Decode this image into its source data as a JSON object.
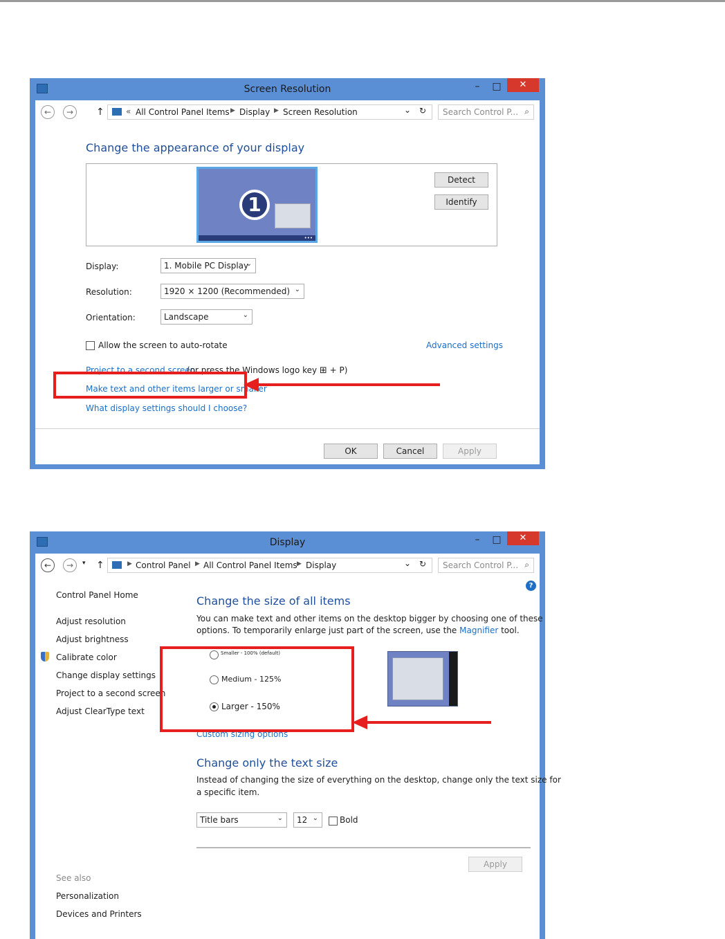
{
  "window1": {
    "title": "Screen Resolution",
    "minimize": "–",
    "maximize": "□",
    "close": "✕",
    "address": {
      "back": "←",
      "forward": "→",
      "up": "↑",
      "overflow": "«",
      "crumbs": [
        "All Control Panel Items",
        "Display",
        "Screen Resolution"
      ],
      "dropdown": "⌄",
      "refresh": "↻",
      "search_placeholder": "Search Control P...",
      "search_icon": "magnifier-icon"
    },
    "heading": "Change the appearance of your display",
    "monitor_number": "1",
    "monitor_dots": "•••",
    "detect": "Detect",
    "identify": "Identify",
    "display_label": "Display:",
    "display_value": "1. Mobile PC Display",
    "resolution_label": "Resolution:",
    "resolution_value": "1920 × 1200 (Recommended)",
    "orientation_label": "Orientation:",
    "orientation_value": "Landscape",
    "autorotate_label": "Allow the screen to auto-rotate",
    "advanced_link": "Advanced settings",
    "project_link": "Project to a second screen",
    "project_suffix_a": " (or press the Windows logo key ",
    "project_suffix_b": " + P)",
    "larger_link": "Make text and other items larger or smaller",
    "which_link": "What display settings should I choose?",
    "ok": "OK",
    "cancel": "Cancel",
    "apply": "Apply"
  },
  "window2": {
    "title": "Display",
    "minimize": "–",
    "maximize": "□",
    "close": "✕",
    "address": {
      "back": "←",
      "forward": "→",
      "recent": "▾",
      "up": "↑",
      "crumbs": [
        "Control Panel",
        "All Control Panel Items",
        "Display"
      ],
      "dropdown": "⌄",
      "refresh": "↻",
      "search_placeholder": "Search Control P...",
      "search_icon": "magnifier-icon"
    },
    "help": "?",
    "sidebar": {
      "home": "Control Panel Home",
      "items": [
        "Adjust resolution",
        "Adjust brightness",
        "Calibrate color",
        "Change display settings",
        "Project to a second screen",
        "Adjust ClearType text"
      ],
      "see_also": "See also",
      "see_also_items": [
        "Personalization",
        "Devices and Printers"
      ]
    },
    "size_heading": "Change the size of all items",
    "size_desc_1": "You can make text and other items on the desktop bigger by choosing one of these",
    "size_desc_2a": "options. To temporarily enlarge just part of the screen, use the ",
    "magnifier_link": "Magnifier",
    "size_desc_2b": " tool.",
    "options": [
      "Smaller - 100% (default)",
      "Medium - 125%",
      "Larger - 150%"
    ],
    "selected_option": "Larger - 150%",
    "custom_link": "Custom sizing options",
    "text_heading": "Change only the text size",
    "text_desc_1": "Instead of changing the size of everything on the desktop, change only the text size for",
    "text_desc_2": "a specific item.",
    "item_select": "Title bars",
    "size_select": "12",
    "bold_label": "Bold",
    "apply": "Apply"
  },
  "colors": {
    "window_frame": "#5a8fd6",
    "close_button": "#d6392b",
    "heading": "#1f4e9a",
    "link": "#1a6fc9",
    "annotation": "#e61e1e"
  }
}
